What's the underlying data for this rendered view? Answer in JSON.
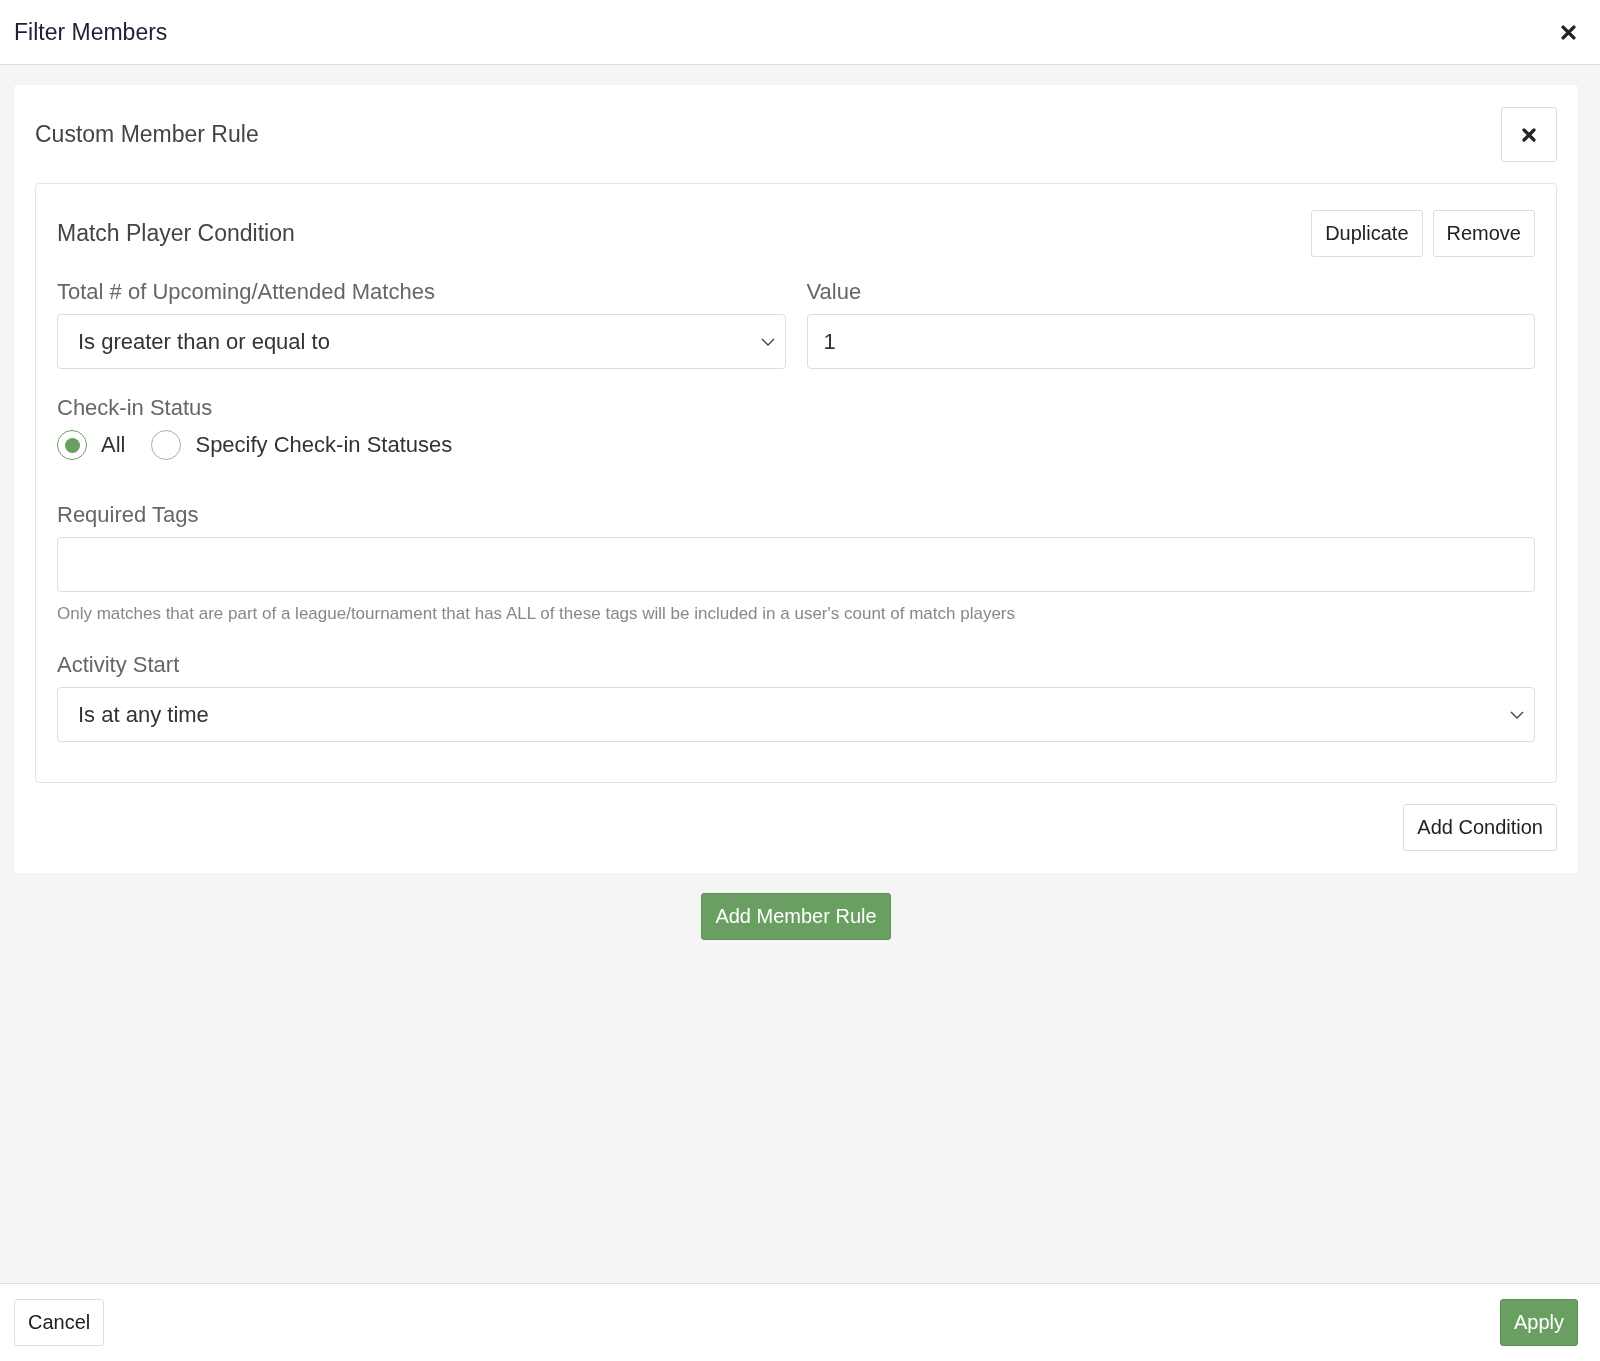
{
  "dialog": {
    "title": "Filter Members"
  },
  "rule": {
    "title": "Custom Member Rule",
    "condition": {
      "title": "Match Player Condition",
      "actions": [
        "Duplicate",
        "Remove"
      ],
      "count": {
        "label": "Total # of Upcoming/Attended Matches",
        "value": "Is greater than or equal to"
      },
      "value": {
        "label": "Value",
        "value": "1"
      },
      "checkin": {
        "label": "Check-in Status",
        "options": [
          {
            "label": "All",
            "selected": true
          },
          {
            "label": "Specify Check-in Statuses",
            "selected": false
          }
        ]
      },
      "tags": {
        "label": "Required Tags",
        "help": "Only matches that are part of a league/tournament that has ALL of these tags will be included in a user's count of match players"
      },
      "activity": {
        "label": "Activity Start",
        "value": "Is at any time"
      }
    },
    "add_condition": "Add Condition"
  },
  "add_member_rule": "Add Member Rule",
  "footer": {
    "cancel": "Cancel",
    "apply": "Apply"
  }
}
